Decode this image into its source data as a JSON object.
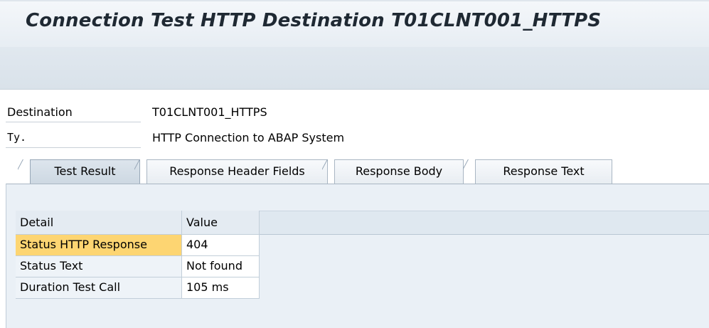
{
  "header": {
    "title": "Connection Test HTTP Destination T01CLNT001_HTTPS"
  },
  "fields": {
    "destination": {
      "label": "Destination",
      "value": "T01CLNT001_HTTPS"
    },
    "type": {
      "label": "Ty.",
      "value": "HTTP Connection to ABAP System"
    }
  },
  "tabs": [
    {
      "label": "Test Result",
      "active": true
    },
    {
      "label": "Response Header Fields"
    },
    {
      "label": "Response Body"
    },
    {
      "label": "Response Text"
    }
  ],
  "table": {
    "columns": [
      "Detail",
      "Value"
    ],
    "rows": [
      {
        "detail": "Status HTTP Response",
        "value": "404",
        "selected": true
      },
      {
        "detail": "Status Text",
        "value": "Not found"
      },
      {
        "detail": "Duration Test Call",
        "value": "105 ms"
      }
    ]
  },
  "colors": {
    "selected_cell": "#fdd572",
    "panel_bg": "#eaf0f6",
    "title_text": "#1f2933"
  }
}
